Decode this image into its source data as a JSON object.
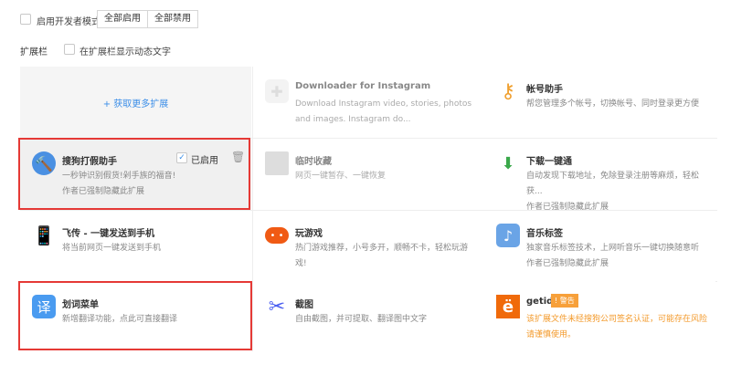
{
  "toolbar": {
    "dev_mode_label": "启用开发者模式",
    "enable_all": "全部启用",
    "disable_all": "全部禁用"
  },
  "extbar": {
    "label": "扩展栏",
    "show_dynamic_text": "在扩展栏显示动态文字"
  },
  "get_more": "+ 获取更多扩展",
  "extensions": [
    {
      "title": "Downloader for Instagram",
      "desc": "Download Instagram video, stories, photos and images. Instagram do...",
      "icon": "puzzle-icon"
    },
    {
      "title": "帐号助手",
      "desc": "帮您管理多个帐号，切换帐号、同时登录更方便",
      "icon": "key-icon"
    },
    {
      "title": "搜狗打假助手",
      "desc": "一秒钟识别假货!剁手族的福音!",
      "note": "作者已强制隐藏此扩展",
      "enabled_label": "已启用",
      "icon": "hammer-icon"
    },
    {
      "title": "临时收藏",
      "desc": "网页一键暂存、一键恢复",
      "icon": "window-icon"
    },
    {
      "title": "下载一键通",
      "desc": "自动发现下载地址，免除登录注册等麻烦，轻松获...",
      "note": "作者已强制隐藏此扩展",
      "icon": "download-icon"
    },
    {
      "title": "飞传 - 一键发送到手机",
      "desc": "将当前网页一键发送到手机",
      "icon": "phone-send-icon"
    },
    {
      "title": "玩游戏",
      "desc": "热门游戏推荐，小号多开，顺畅不卡，轻松玩游戏!",
      "icon": "gamepad-icon"
    },
    {
      "title": "音乐标签",
      "desc": "独家音乐标签技术，上网听音乐一键切换随意听",
      "note": "作者已强制隐藏此扩展",
      "icon": "music-icon"
    },
    {
      "title": "划词菜单",
      "desc": "新增翻译功能，点此可直接翻译",
      "icon": "translate-icon",
      "glyph": "译"
    },
    {
      "title": "截图",
      "desc": "自由截图，并可提取、翻译图中文字",
      "icon": "scissors-icon"
    },
    {
      "title": "getid",
      "badge": "! 警告",
      "desc": "该扩展文件未经搜狗公司签名认证，可能存在风险请谨慎使用。",
      "icon": "getid-icon",
      "glyph": "ë"
    }
  ]
}
